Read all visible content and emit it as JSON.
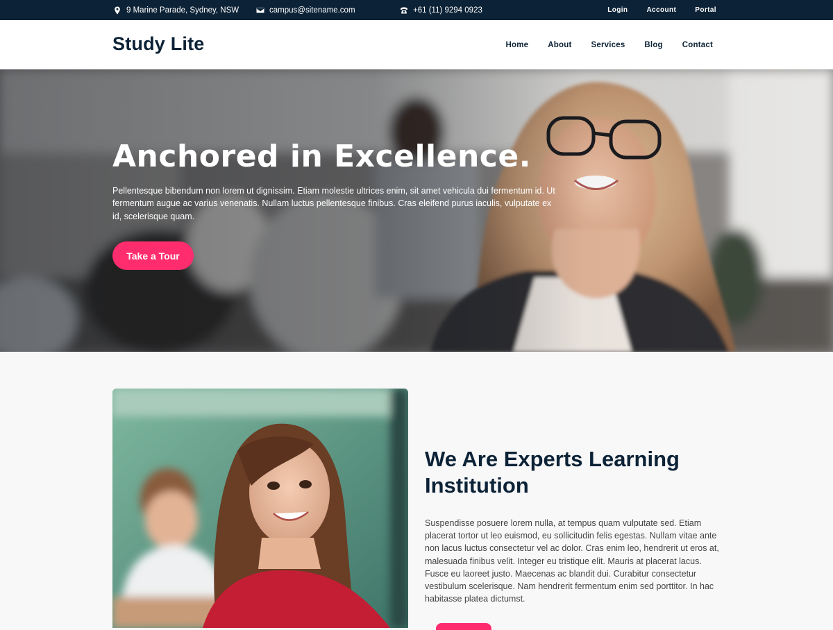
{
  "topbar": {
    "address": "9 Marine Parade, Sydney, NSW",
    "email": "campus@sitename.com",
    "phone": "+61 (11) 9294 0923",
    "links": [
      "Login",
      "Account",
      "Portal"
    ],
    "background": "#0c2236"
  },
  "header": {
    "logo": "Study Lite",
    "nav": [
      "Home",
      "About",
      "Services",
      "Blog",
      "Contact"
    ]
  },
  "hero": {
    "title": "Anchored in Excellence.",
    "text": "Pellentesque bibendum non lorem ut dignissim. Etiam molestie ultrices enim, sit amet vehicula dui fermentum id. Ut fermentum augue ac varius venenatis. Nullam luctus pellentesque finibus. Cras eleifend purus iaculis, vulputate ex id, scelerisque quam.",
    "button": "Take a Tour",
    "accent": "#ff2d6e"
  },
  "about": {
    "title": "We Are Experts Learning Institution",
    "text": "Suspendisse posuere lorem nulla, at tempus quam vulputate sed. Etiam placerat tortor ut leo euismod, eu sollicitudin felis egestas. Nullam vitae ante non lacus luctus consectetur vel ac dolor. Cras enim leo, hendrerit ut eros at, malesuada finibus velit. Integer eu tristique elit. Mauris at placerat lacus. Fusce eu laoreet justo. Maecenas ac blandit dui. Curabitur consectetur vestibulum scelerisque. Nam hendrerit fermentum enim sed porttitor. In hac habitasse platea dictumst."
  },
  "icons": {
    "address": "map-pin-icon",
    "email": "envelope-icon",
    "phone": "phone-icon"
  }
}
